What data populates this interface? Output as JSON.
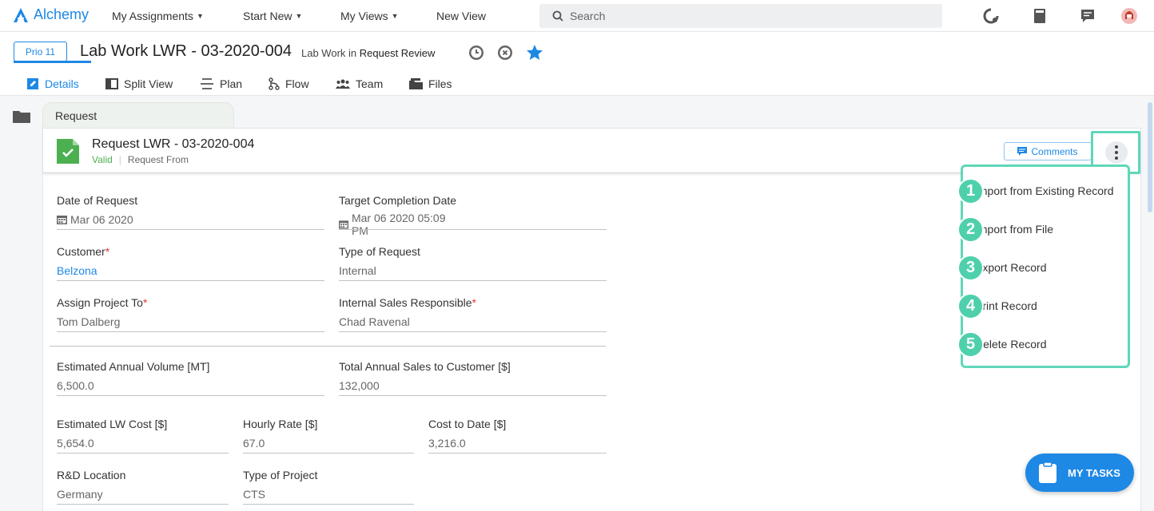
{
  "topbar": {
    "app_name": "Alchemy",
    "nav": [
      {
        "label": "My Assignments"
      },
      {
        "label": "Start New"
      },
      {
        "label": "My Views"
      },
      {
        "label": "New View"
      }
    ],
    "search_placeholder": "Search"
  },
  "header": {
    "priority": "Prio 11",
    "title": "Lab Work LWR - 03-2020-004",
    "subtitle_prefix": "Lab Work in",
    "subtitle_status": "Request Review",
    "tabs": [
      {
        "label": "Details",
        "icon": "edit-icon"
      },
      {
        "label": "Split View",
        "icon": "split-view-icon"
      },
      {
        "label": "Plan",
        "icon": "plan-icon"
      },
      {
        "label": "Flow",
        "icon": "flow-icon"
      },
      {
        "label": "Team",
        "icon": "team-icon"
      },
      {
        "label": "Files",
        "icon": "files-icon"
      }
    ]
  },
  "card": {
    "section_tab": "Request",
    "title": "Request LWR - 03-2020-004",
    "status": "Valid",
    "source": "Request From",
    "comments_label": "Comments"
  },
  "fields": {
    "date_of_request": {
      "label": "Date of Request",
      "value": "Mar 06 2020"
    },
    "target_completion": {
      "label": "Target Completion Date",
      "value": "Mar 06 2020 05:09 PM"
    },
    "customer": {
      "label": "Customer",
      "value": "Belzona"
    },
    "type_of_request": {
      "label": "Type of Request",
      "value": "Internal"
    },
    "assign_project": {
      "label": "Assign Project To",
      "value": "Tom Dalberg"
    },
    "sales_responsible": {
      "label": "Internal Sales Responsible",
      "value": "Chad Ravenal"
    },
    "annual_volume": {
      "label": "Estimated Annual Volume [MT]",
      "value": "6,500.0"
    },
    "annual_sales": {
      "label": "Total Annual Sales to Customer [$]",
      "value": "132,000"
    },
    "lw_cost": {
      "label": "Estimated LW Cost [$]",
      "value": "5,654.0"
    },
    "hourly_rate": {
      "label": "Hourly Rate [$]",
      "value": "67.0"
    },
    "cost_to_date": {
      "label": "Cost to Date [$]",
      "value": "3,216.0"
    },
    "rd_location": {
      "label": "R&D Location",
      "value": "Germany"
    },
    "type_of_project": {
      "label": "Type of Project",
      "value": "CTS"
    }
  },
  "menu": {
    "items": [
      {
        "num": "1",
        "label": "Import from Existing Record"
      },
      {
        "num": "2",
        "label": "Import from File"
      },
      {
        "num": "3",
        "label": "Export Record"
      },
      {
        "num": "4",
        "label": "Print Record"
      },
      {
        "num": "5",
        "label": "Delete Record"
      }
    ]
  },
  "my_tasks_label": "MY TASKS",
  "colors": {
    "accent": "#1e88e5",
    "highlight": "#5fd7b8",
    "valid": "#4caf50",
    "required": "#e53935"
  }
}
